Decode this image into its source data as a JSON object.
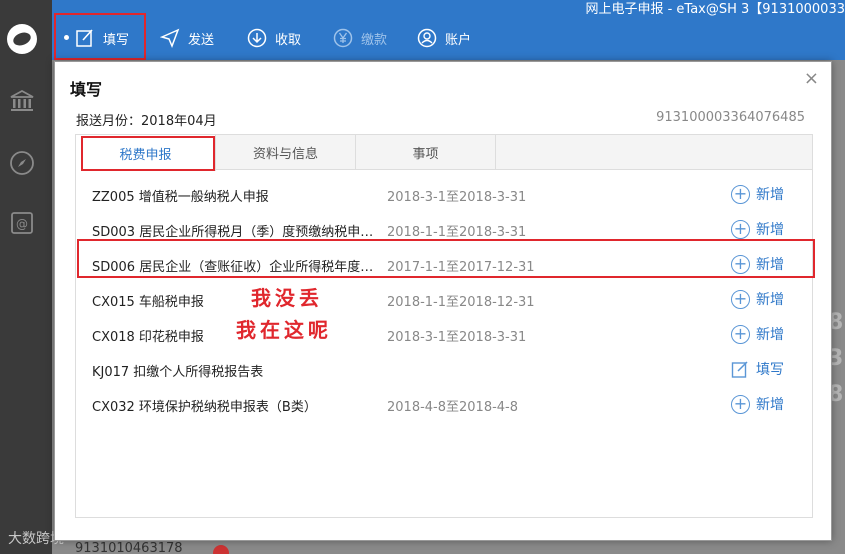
{
  "window": {
    "title": "网上电子申报 - eTax@SH 3【9131000033"
  },
  "toolbar": [
    {
      "label": "填写",
      "icon": "edit-icon",
      "active": true,
      "disabled": false
    },
    {
      "label": "发送",
      "icon": "send-icon",
      "active": false,
      "disabled": false
    },
    {
      "label": "收取",
      "icon": "download-icon",
      "active": false,
      "disabled": false
    },
    {
      "label": "缴款",
      "icon": "yen-icon",
      "active": false,
      "disabled": true
    },
    {
      "label": "账户",
      "icon": "user-icon",
      "active": false,
      "disabled": false
    }
  ],
  "dialog": {
    "title": "填写",
    "close": "×",
    "month_label": "报送月份：2018年04月",
    "tax_id": "913100003364076485",
    "tabs": [
      "税费申报",
      "资料与信息",
      "事项"
    ],
    "rows": [
      {
        "code": "ZZ005  增值税一般纳税人申报",
        "period": "2018-3-1至2018-3-31",
        "action": "新增",
        "action_icon": "plus-circle-icon"
      },
      {
        "code": "SD003  居民企业所得税月（季）度预缴纳税申…",
        "period": "2018-1-1至2018-3-31",
        "action": "新增",
        "action_icon": "plus-circle-icon"
      },
      {
        "code": "SD006  居民企业（查账征收）企业所得税年度…",
        "period": "2017-1-1至2017-12-31",
        "action": "新增",
        "action_icon": "plus-circle-icon"
      },
      {
        "code": "CX015  车船税申报",
        "period": "2018-1-1至2018-12-31",
        "action": "新增",
        "action_icon": "plus-circle-icon"
      },
      {
        "code": "CX018  印花税申报",
        "period": "2018-3-1至2018-3-31",
        "action": "新增",
        "action_icon": "plus-circle-icon"
      },
      {
        "code": "KJ017  扣缴个人所得税报告表",
        "period": "",
        "action": "填写",
        "action_icon": "edit-icon"
      },
      {
        "code": "CX032  环境保护税纳税申报表（B类）",
        "period": "2018-4-8至2018-4-8",
        "action": "新增",
        "action_icon": "plus-circle-icon"
      }
    ]
  },
  "annotation": {
    "line1": "我没丢",
    "line2": "我在这呢"
  },
  "background": {
    "footer_text": "9131010463178",
    "watermark": "大数跨境",
    "side_numbers": [
      "8",
      "3",
      "8"
    ]
  },
  "colors": {
    "accent": "#2f78c9",
    "highlight": "#e0272d"
  }
}
